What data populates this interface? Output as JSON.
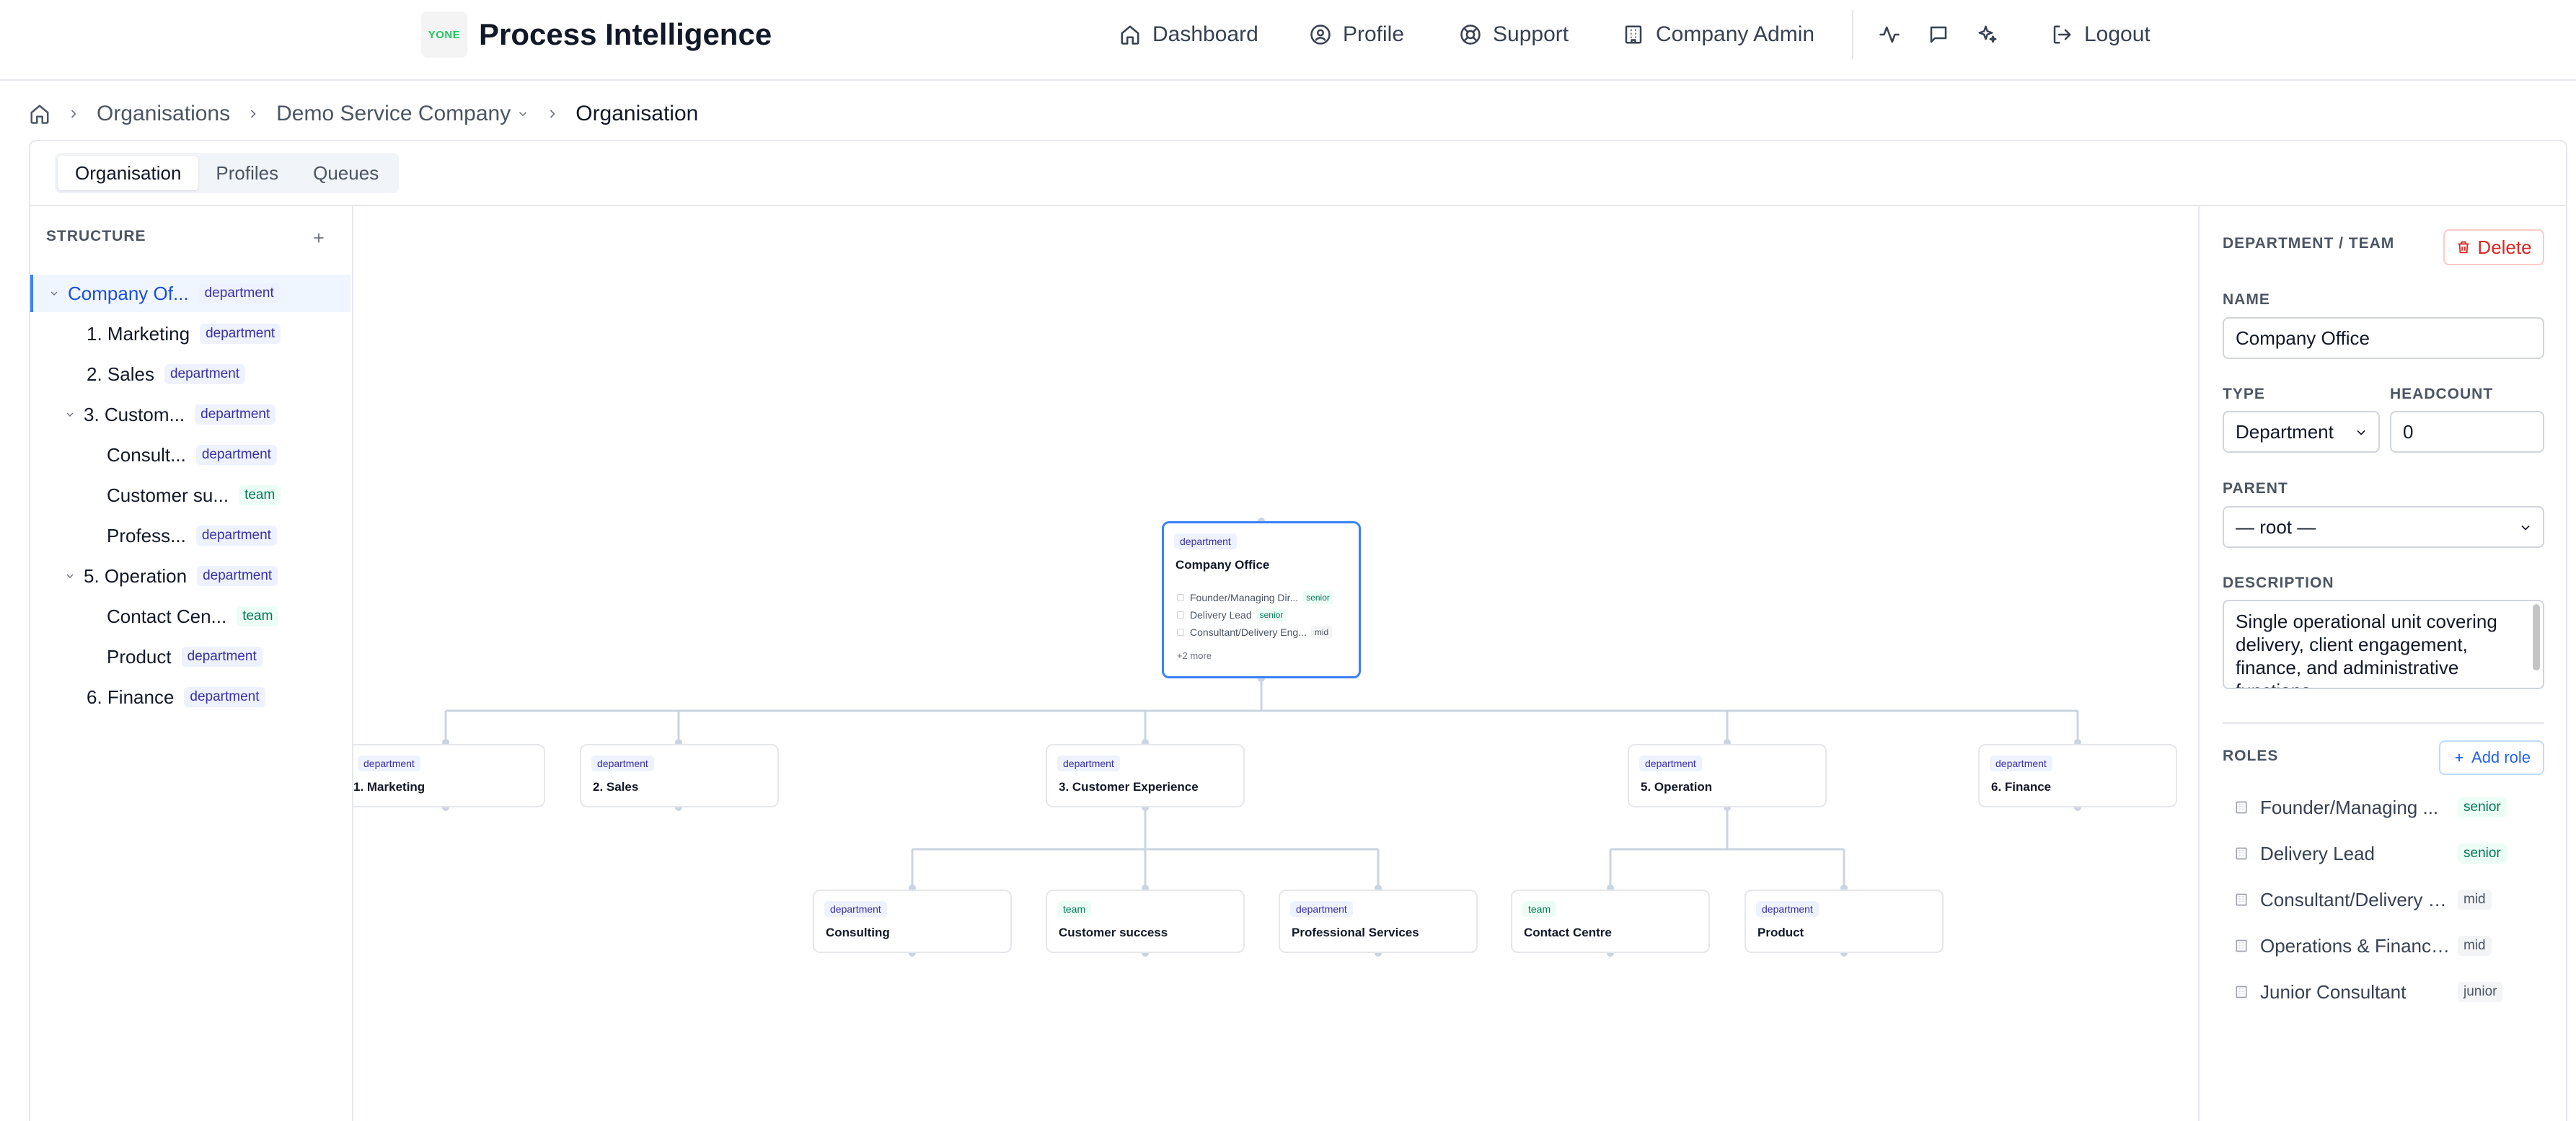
{
  "app": {
    "logo_text": "YONE",
    "title": "Process Intelligence"
  },
  "nav": [
    {
      "label": "Dashboard",
      "icon": "home-icon"
    },
    {
      "label": "Profile",
      "icon": "user-circle-icon"
    },
    {
      "label": "Support",
      "icon": "lifebuoy-icon"
    },
    {
      "label": "Company Admin",
      "icon": "building-icon"
    },
    {
      "label": "Logout",
      "icon": "logout-icon"
    }
  ],
  "breadcrumb": {
    "items": [
      "Organisations",
      "Demo Service Company"
    ],
    "current": "Organisation"
  },
  "tabs": [
    "Organisation",
    "Profiles",
    "Queues"
  ],
  "structure": {
    "label": "STRUCTURE",
    "items": [
      {
        "name": "Company Of...",
        "type": "department",
        "expanded": true,
        "selected": true
      },
      {
        "name": "1. Marketing",
        "type": "department"
      },
      {
        "name": "2. Sales",
        "type": "department"
      },
      {
        "name": "3. Custom...",
        "type": "department",
        "expanded": true
      },
      {
        "name": "Consult...",
        "type": "department"
      },
      {
        "name": "Customer su...",
        "type": "team"
      },
      {
        "name": "Profess...",
        "type": "department"
      },
      {
        "name": "5. Operation",
        "type": "department",
        "expanded": true
      },
      {
        "name": "Contact Cen...",
        "type": "team"
      },
      {
        "name": "Product",
        "type": "department"
      },
      {
        "name": "6. Finance",
        "type": "department"
      }
    ]
  },
  "chart": {
    "root": {
      "type": "department",
      "title": "Company Office",
      "roles": [
        {
          "name": "Founder/Managing Dir...",
          "level": "senior"
        },
        {
          "name": "Delivery Lead",
          "level": "senior"
        },
        {
          "name": "Consultant/Delivery Eng...",
          "level": "mid"
        }
      ],
      "more": "+2 more"
    },
    "level1": [
      {
        "type": "department",
        "title": "1. Marketing"
      },
      {
        "type": "department",
        "title": "2. Sales"
      },
      {
        "type": "department",
        "title": "3. Customer Experience"
      },
      {
        "type": "department",
        "title": "5. Operation"
      },
      {
        "type": "department",
        "title": "6. Finance"
      }
    ],
    "level2": [
      {
        "type": "department",
        "title": "Consulting"
      },
      {
        "type": "team",
        "title": "Customer success"
      },
      {
        "type": "department",
        "title": "Professional Services"
      },
      {
        "type": "team",
        "title": "Contact Centre"
      },
      {
        "type": "department",
        "title": "Product"
      }
    ]
  },
  "details": {
    "section_label": "DEPARTMENT / TEAM",
    "delete_label": "Delete",
    "name_label": "NAME",
    "name_value": "Company Office",
    "type_label": "TYPE",
    "type_value": "Department",
    "headcount_label": "HEADCOUNT",
    "headcount_value": "0",
    "parent_label": "PARENT",
    "parent_value": "— root —",
    "description_label": "DESCRIPTION",
    "description_value": "Single operational unit covering delivery, client engagement, finance, and administrative functions.",
    "roles_label": "ROLES",
    "add_role_label": "Add role",
    "roles": [
      {
        "name": "Founder/Managing ...",
        "level": "senior"
      },
      {
        "name": "Delivery Lead",
        "level": "senior"
      },
      {
        "name": "Consultant/Delivery E...",
        "level": "mid"
      },
      {
        "name": "Operations & Finance...",
        "level": "mid"
      },
      {
        "name": "Junior Consultant",
        "level": "junior"
      }
    ]
  },
  "colors": {
    "accent": "#3b82f6",
    "danger": "#dc2626",
    "department_badge": "#eef2ff",
    "team_badge": "#ecfdf5"
  }
}
